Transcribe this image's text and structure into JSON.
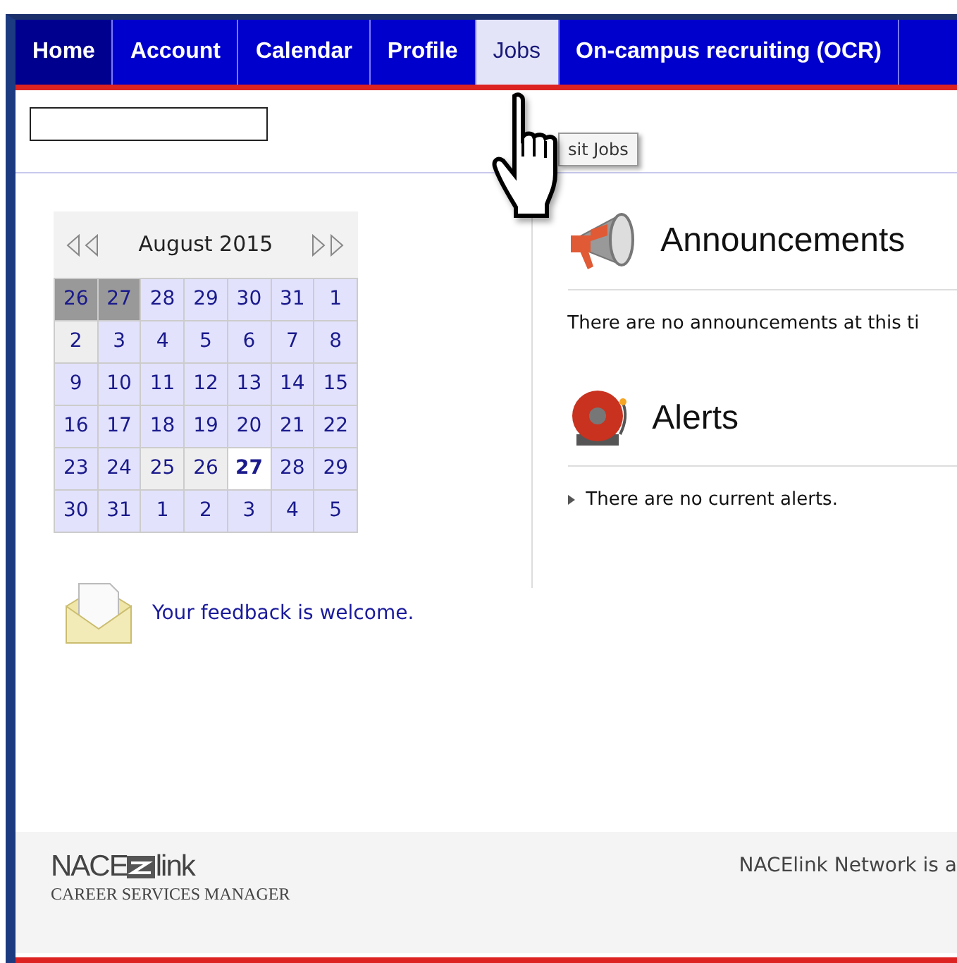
{
  "nav": {
    "tabs": [
      {
        "label": "Home",
        "selected": true,
        "hovered": false
      },
      {
        "label": "Account",
        "selected": false,
        "hovered": false
      },
      {
        "label": "Calendar",
        "selected": false,
        "hovered": false
      },
      {
        "label": "Profile",
        "selected": false,
        "hovered": false
      },
      {
        "label": "Jobs",
        "selected": false,
        "hovered": true
      },
      {
        "label": "On-campus recruiting (OCR)",
        "selected": false,
        "hovered": false
      }
    ]
  },
  "tooltip": "sit Jobs",
  "calendar": {
    "title": "August 2015",
    "days": [
      {
        "day": "26",
        "kind": "shaded"
      },
      {
        "day": "27",
        "kind": "shaded"
      },
      {
        "day": "28",
        "kind": "normal"
      },
      {
        "day": "29",
        "kind": "normal"
      },
      {
        "day": "30",
        "kind": "normal"
      },
      {
        "day": "31",
        "kind": "normal"
      },
      {
        "day": "1",
        "kind": "normal"
      },
      {
        "day": "2",
        "kind": "weekend"
      },
      {
        "day": "3",
        "kind": "normal"
      },
      {
        "day": "4",
        "kind": "normal"
      },
      {
        "day": "5",
        "kind": "normal"
      },
      {
        "day": "6",
        "kind": "normal"
      },
      {
        "day": "7",
        "kind": "normal"
      },
      {
        "day": "8",
        "kind": "normal"
      },
      {
        "day": "9",
        "kind": "normal"
      },
      {
        "day": "10",
        "kind": "normal"
      },
      {
        "day": "11",
        "kind": "normal"
      },
      {
        "day": "12",
        "kind": "normal"
      },
      {
        "day": "13",
        "kind": "normal"
      },
      {
        "day": "14",
        "kind": "normal"
      },
      {
        "day": "15",
        "kind": "normal"
      },
      {
        "day": "16",
        "kind": "normal"
      },
      {
        "day": "17",
        "kind": "normal"
      },
      {
        "day": "18",
        "kind": "normal"
      },
      {
        "day": "19",
        "kind": "normal"
      },
      {
        "day": "20",
        "kind": "normal"
      },
      {
        "day": "21",
        "kind": "normal"
      },
      {
        "day": "22",
        "kind": "normal"
      },
      {
        "day": "23",
        "kind": "normal"
      },
      {
        "day": "24",
        "kind": "normal"
      },
      {
        "day": "25",
        "kind": "weekend"
      },
      {
        "day": "26",
        "kind": "weekend"
      },
      {
        "day": "27",
        "kind": "today"
      },
      {
        "day": "28",
        "kind": "normal"
      },
      {
        "day": "29",
        "kind": "normal"
      },
      {
        "day": "30",
        "kind": "normal"
      },
      {
        "day": "31",
        "kind": "normal"
      },
      {
        "day": "1",
        "kind": "normal"
      },
      {
        "day": "2",
        "kind": "normal"
      },
      {
        "day": "3",
        "kind": "normal"
      },
      {
        "day": "4",
        "kind": "normal"
      },
      {
        "day": "5",
        "kind": "normal"
      }
    ]
  },
  "feedback": "Your feedback is welcome.",
  "announcements": {
    "title": "Announcements",
    "text": "There are no announcements at this ti"
  },
  "alerts": {
    "title": "Alerts",
    "text": "There are no current alerts."
  },
  "footer": {
    "logo_left": "NACE",
    "logo_right": "link",
    "logo_subtitle": "CAREER SERVICES MANAGER",
    "text": "NACElink Network is a"
  }
}
